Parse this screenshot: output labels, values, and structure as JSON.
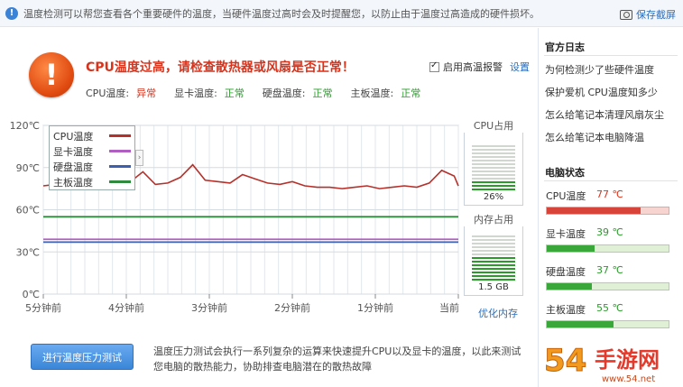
{
  "topbar": {
    "message": "温度检测可以帮您查看各个重要硬件的温度，当硬件温度过高时会及时提醒您，以防止由于温度过高造成的硬件损坏。",
    "save_screenshot": "保存截屏"
  },
  "alert": {
    "icon": "exclamation-icon",
    "title": "CPU温度过高，请检查散热器或风扇是否正常！",
    "alarm_label": "启用高温报警",
    "alarm_checked": true,
    "settings_label": "设置"
  },
  "status": [
    {
      "label": "CPU温度:",
      "value": "异常",
      "state": "bad"
    },
    {
      "label": "显卡温度:",
      "value": "正常",
      "state": "ok"
    },
    {
      "label": "硬盘温度:",
      "value": "正常",
      "state": "ok"
    },
    {
      "label": "主板温度:",
      "value": "正常",
      "state": "ok"
    }
  ],
  "chart_data": {
    "type": "line",
    "yticks": [
      "120℃",
      "90℃",
      "60℃",
      "30℃",
      "0℃"
    ],
    "ylim": [
      0,
      120
    ],
    "xticks": [
      "5分钟前",
      "4分钟前",
      "3分钟前",
      "2分钟前",
      "1分钟前",
      "当前"
    ],
    "x": [
      -5.0,
      -4.85,
      -4.7,
      -4.55,
      -4.4,
      -4.25,
      -4.1,
      -3.95,
      -3.8,
      -3.65,
      -3.5,
      -3.35,
      -3.2,
      -3.05,
      -2.9,
      -2.75,
      -2.6,
      -2.45,
      -2.3,
      -2.15,
      -2.0,
      -1.85,
      -1.7,
      -1.55,
      -1.4,
      -1.25,
      -1.1,
      -0.95,
      -0.8,
      -0.65,
      -0.5,
      -0.35,
      -0.2,
      -0.05,
      0.0
    ],
    "grid": true,
    "legend": {
      "position": "top-left",
      "collapsible": true
    },
    "series": [
      {
        "name": "CPU温度",
        "color": "#b5312b",
        "values": [
          77,
          78,
          84,
          80,
          77,
          85,
          78,
          80,
          87,
          78,
          79,
          83,
          92,
          81,
          80,
          79,
          85,
          82,
          79,
          78,
          80,
          77,
          76,
          76,
          75,
          76,
          77,
          75,
          76,
          77,
          76,
          79,
          88,
          84,
          77
        ]
      },
      {
        "name": "显卡温度",
        "color": "#b05ec2",
        "values": [
          39,
          39,
          39,
          39,
          39,
          39,
          39,
          39,
          39,
          39,
          39,
          39,
          39,
          39,
          39,
          39,
          39,
          39,
          39,
          39,
          39,
          39,
          39,
          39,
          39,
          39,
          39,
          39,
          39,
          39,
          39,
          39,
          39,
          39,
          39
        ]
      },
      {
        "name": "硬盘温度",
        "color": "#3d5fb0",
        "values": [
          37,
          37,
          37,
          37,
          37,
          37,
          37,
          37,
          37,
          37,
          37,
          37,
          37,
          37,
          37,
          37,
          37,
          37,
          37,
          37,
          37,
          37,
          37,
          37,
          37,
          37,
          37,
          37,
          37,
          37,
          37,
          37,
          37,
          37,
          37
        ]
      },
      {
        "name": "主板温度",
        "color": "#2f8a3e",
        "values": [
          55,
          55,
          55,
          55,
          55,
          55,
          55,
          55,
          55,
          55,
          55,
          55,
          55,
          55,
          55,
          55,
          55,
          55,
          55,
          55,
          55,
          55,
          55,
          55,
          55,
          55,
          55,
          55,
          55,
          55,
          55,
          55,
          55,
          55,
          55
        ]
      }
    ]
  },
  "cpu_usage": {
    "title": "CPU占用",
    "value": "26%",
    "fraction": 0.26
  },
  "mem_usage": {
    "title": "内存占用",
    "value": "1.5 GB",
    "fraction": 0.5
  },
  "optimize_memory": "优化内存",
  "stress_test": {
    "button": "进行温度压力测试",
    "description": "温度压力测试会执行一系列复杂的运算来快速提升CPU以及显卡的温度，以此来测试您电脑的散热能力，协助排查电脑潜在的散热故障"
  },
  "sidebar": {
    "log_title": "官方日志",
    "logs": [
      "为何检测少了些硬件温度",
      "保护爱机 CPU温度知多少",
      "怎么给笔记本清理风扇灰尘",
      "怎么给笔记本电脑降温"
    ],
    "status_title": "电脑状态",
    "stats": [
      {
        "name": "CPU温度",
        "value": "77 ℃",
        "temp": 77,
        "state": "hot",
        "color": "#d9443a"
      },
      {
        "name": "显卡温度",
        "value": "39 ℃",
        "temp": 39,
        "state": "ok",
        "color": "#3aa73a"
      },
      {
        "name": "硬盘温度",
        "value": "37 ℃",
        "temp": 37,
        "state": "ok",
        "color": "#3aa73a"
      },
      {
        "name": "主板温度",
        "value": "55 ℃",
        "temp": 55,
        "state": "ok",
        "color": "#3aa73a"
      }
    ]
  },
  "watermark": "54手游网",
  "watermark_url": "www.54.net"
}
